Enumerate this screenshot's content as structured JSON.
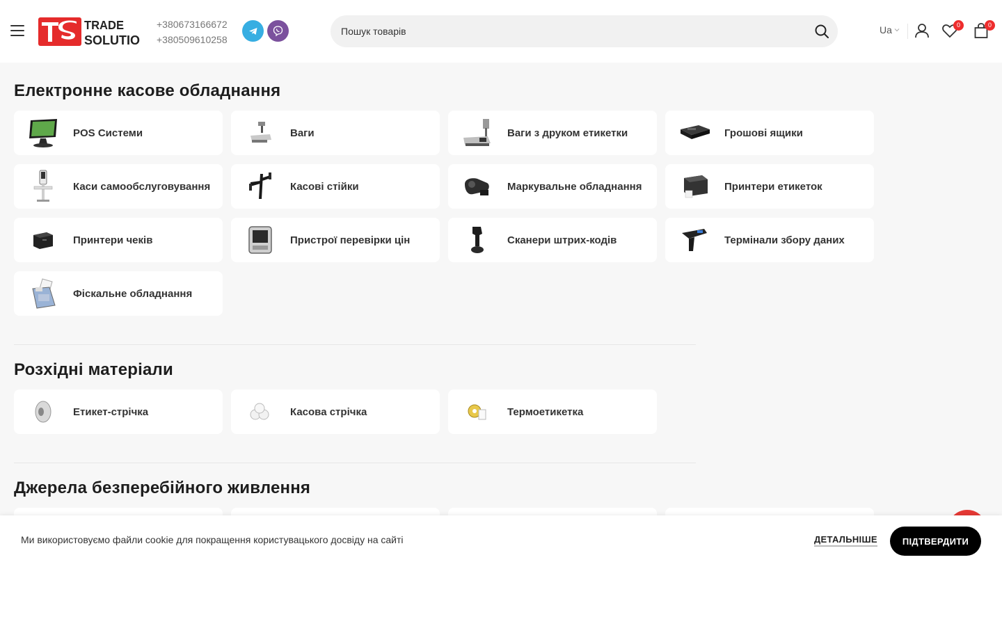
{
  "header": {
    "logo_text": [
      "TRADE",
      "SOLUTIONS"
    ],
    "phones": [
      "+380673166672",
      "+380509610258"
    ],
    "search_placeholder": "Пошук товарів",
    "lang": "Ua",
    "wishlist_count": "0",
    "cart_count": "0"
  },
  "sections": [
    {
      "title": "Електронне касове обладнання",
      "items": [
        {
          "label": "POS Системи",
          "icon": "pos-terminal-icon"
        },
        {
          "label": "Ваги",
          "icon": "scale-icon"
        },
        {
          "label": "Ваги з друком етикетки",
          "icon": "label-scale-icon"
        },
        {
          "label": "Грошові ящики",
          "icon": "cash-drawer-icon"
        },
        {
          "label": "Каси самообслуговування",
          "icon": "self-checkout-icon"
        },
        {
          "label": "Касові стійки",
          "icon": "pos-stand-icon"
        },
        {
          "label": "Маркувальне обладнання",
          "icon": "labeler-icon"
        },
        {
          "label": "Принтери етикеток",
          "icon": "label-printer-icon"
        },
        {
          "label": "Принтери чеків",
          "icon": "receipt-printer-icon"
        },
        {
          "label": "Пристрої перевірки цін",
          "icon": "price-checker-icon"
        },
        {
          "label": "Сканери штрих-кодів",
          "icon": "barcode-scanner-icon"
        },
        {
          "label": "Термінали збору даних",
          "icon": "data-terminal-icon"
        },
        {
          "label": "Фіскальне обладнання",
          "icon": "fiscal-register-icon"
        }
      ]
    },
    {
      "title": "Розхідні матеріали",
      "items": [
        {
          "label": "Етикет-стрічка",
          "icon": "label-roll-icon"
        },
        {
          "label": "Касова стрічка",
          "icon": "receipt-rolls-icon"
        },
        {
          "label": "Термоетикетка",
          "icon": "thermal-label-icon"
        }
      ]
    },
    {
      "title": "Джерела безперебійного живлення",
      "items": []
    }
  ],
  "cookie": {
    "text": "Ми використовуємо файли cookie для покращення користувацького досвіду на сайті",
    "more": "ДЕТАЛЬНІШЕ",
    "confirm": "ПІДТВЕРДИТИ"
  },
  "colors": {
    "accent_red": "#e53935",
    "telegram": "#37aee2",
    "viber": "#7b519d",
    "page_bg": "#f7f7f7"
  }
}
